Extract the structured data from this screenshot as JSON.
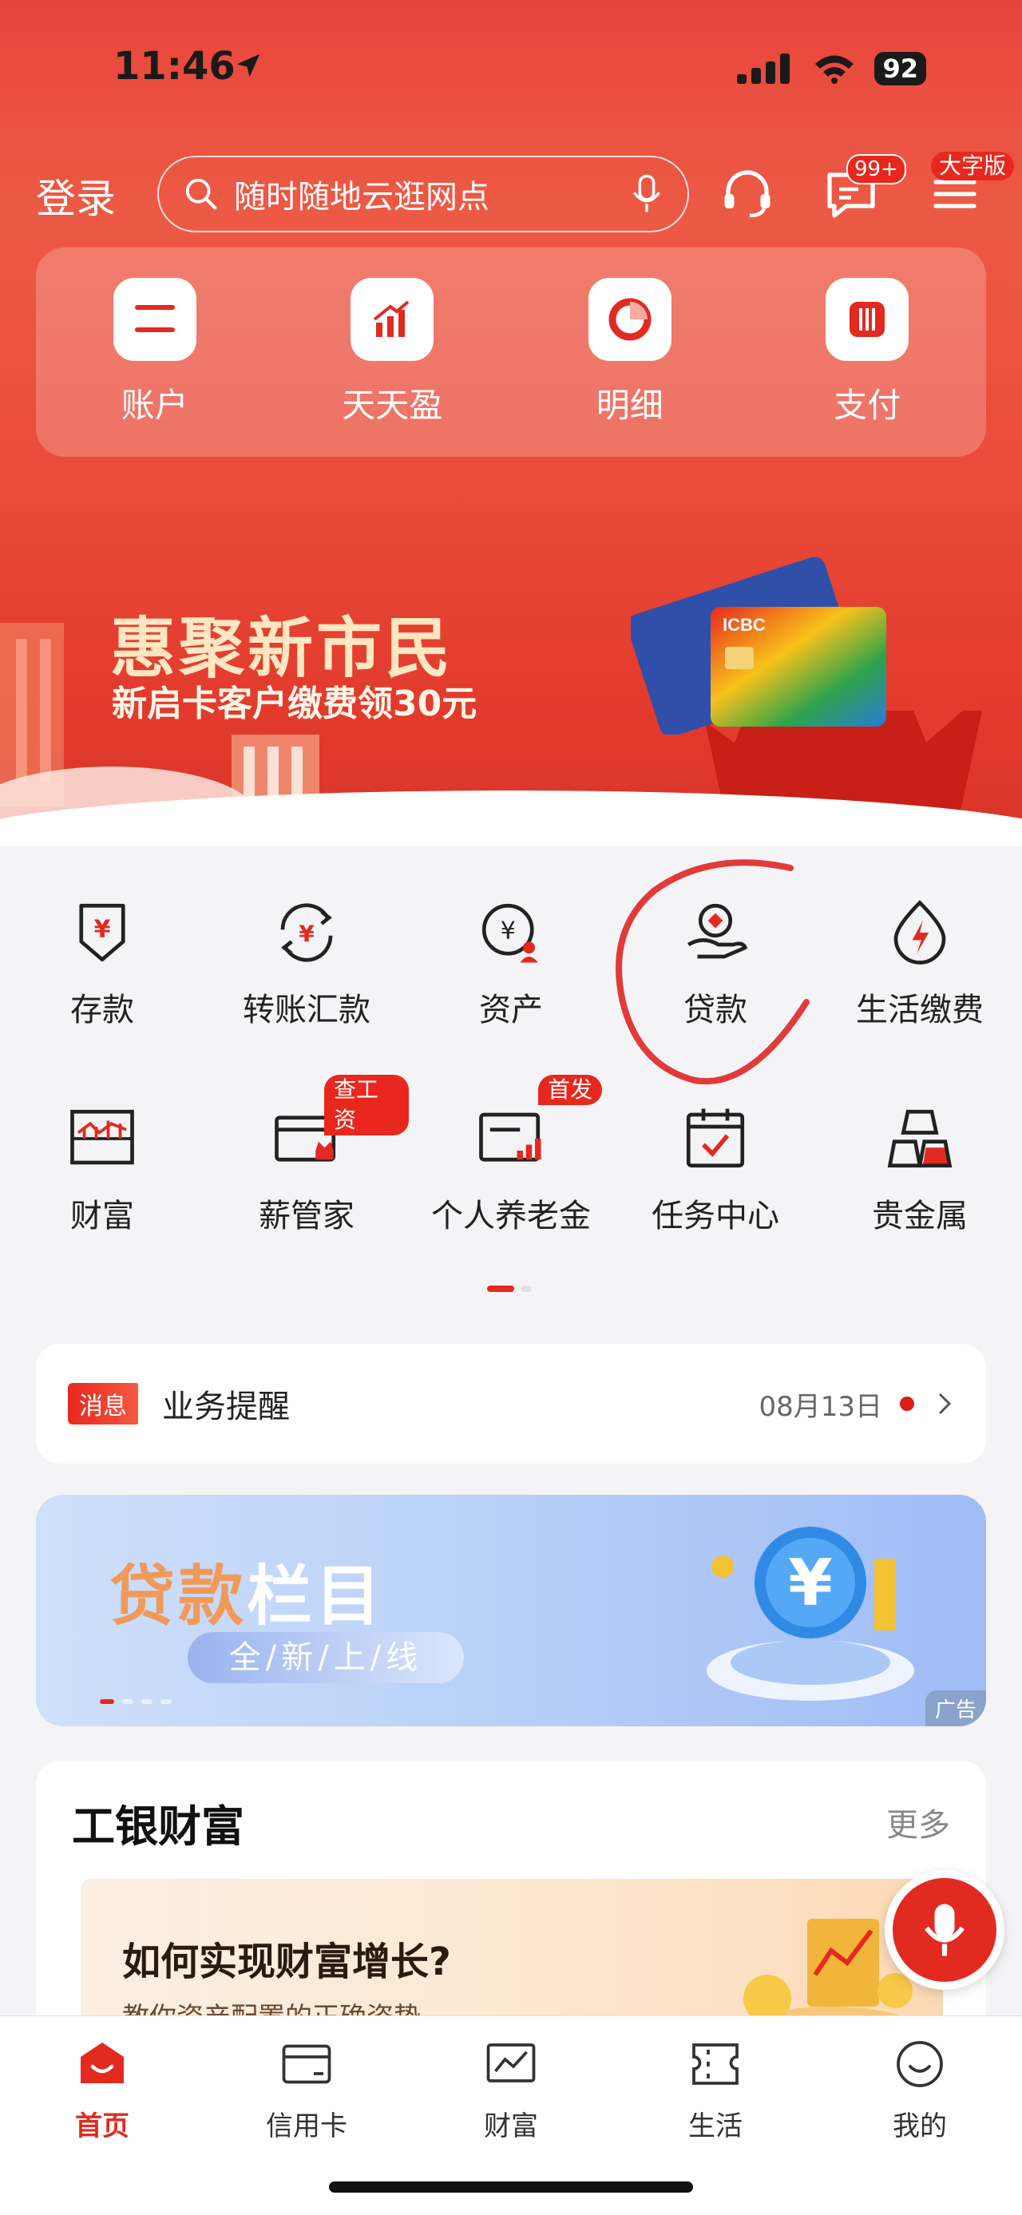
{
  "status_bar": {
    "time": "11:46",
    "battery": "92"
  },
  "header": {
    "login_label": "登录",
    "search_placeholder": "随时随地云逛网点",
    "message_badge": "99+",
    "bigfont_label": "大字版"
  },
  "quick_actions": [
    {
      "label": "账户",
      "icon": "account-card-icon"
    },
    {
      "label": "天天盈",
      "icon": "growth-chart-icon"
    },
    {
      "label": "明细",
      "icon": "pie-chart-icon"
    },
    {
      "label": "支付",
      "icon": "payment-icon"
    }
  ],
  "hero_banner": {
    "title": "惠聚新市民",
    "subtitle": "新启卡客户缴费领30元",
    "card_brand": "ICBC"
  },
  "menu_row1": [
    {
      "label": "存款",
      "icon": "deposit-icon"
    },
    {
      "label": "转账汇款",
      "icon": "transfer-icon"
    },
    {
      "label": "资产",
      "icon": "assets-icon"
    },
    {
      "label": "贷款",
      "icon": "loan-icon"
    },
    {
      "label": "生活缴费",
      "icon": "utility-bill-icon"
    }
  ],
  "menu_row2": [
    {
      "label": "财富",
      "icon": "wealth-icon",
      "tag": ""
    },
    {
      "label": "薪管家",
      "icon": "salary-icon",
      "tag": "查工资"
    },
    {
      "label": "个人养老金",
      "icon": "pension-icon",
      "tag": "首发"
    },
    {
      "label": "任务中心",
      "icon": "task-calendar-icon",
      "tag": ""
    },
    {
      "label": "贵金属",
      "icon": "gold-bars-icon",
      "tag": ""
    }
  ],
  "message": {
    "tag": "消息",
    "title": "业务提醒",
    "date": "08月13日"
  },
  "ad": {
    "title_a": "贷款",
    "title_b": "栏目",
    "subtitle": "全/新/上/线",
    "label": "广告"
  },
  "wealth": {
    "title": "工银财富",
    "more": "更多",
    "card_title": "如何实现财富增长?",
    "card_sub": "教你资产配置的正确姿势"
  },
  "tabs": [
    {
      "label": "首页",
      "icon": "home-icon",
      "active": true
    },
    {
      "label": "信用卡",
      "icon": "credit-card-icon",
      "active": false
    },
    {
      "label": "财富",
      "icon": "wealth-trend-icon",
      "active": false
    },
    {
      "label": "生活",
      "icon": "ticket-icon",
      "active": false
    },
    {
      "label": "我的",
      "icon": "smiley-profile-icon",
      "active": false
    }
  ],
  "colors": {
    "brand_red": "#e22a20",
    "hero_red": "#e8453a"
  }
}
